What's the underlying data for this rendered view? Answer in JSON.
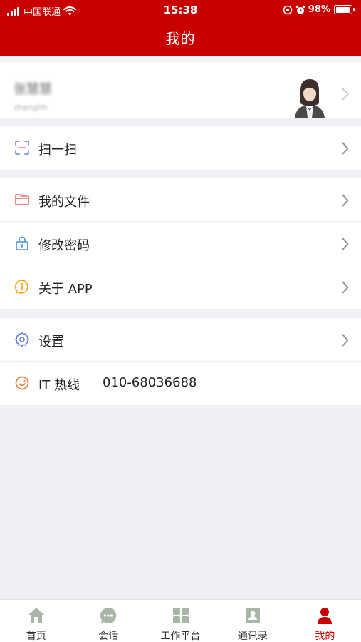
{
  "status_bar": {
    "carrier": "中国联通",
    "time": "15:38",
    "battery": "98%"
  },
  "header": {
    "title": "我的"
  },
  "profile": {
    "name": "张慧慧",
    "id": "zhanghh"
  },
  "menu": {
    "scan": "扫一扫",
    "files": "我的文件",
    "password": "修改密码",
    "about": "关于 APP",
    "settings": "设置",
    "hotline_label": "IT 热线",
    "hotline_number": "010-68036688"
  },
  "tabs": [
    {
      "label": "首页",
      "icon": "home-icon"
    },
    {
      "label": "会话",
      "icon": "chat-icon"
    },
    {
      "label": "工作平台",
      "icon": "apps-grid-icon"
    },
    {
      "label": "通讯录",
      "icon": "contacts-icon"
    },
    {
      "label": "我的",
      "icon": "person-icon"
    }
  ],
  "colors": {
    "brand": "#c90000",
    "inactive_tab_icon": "#a9b6a6"
  }
}
